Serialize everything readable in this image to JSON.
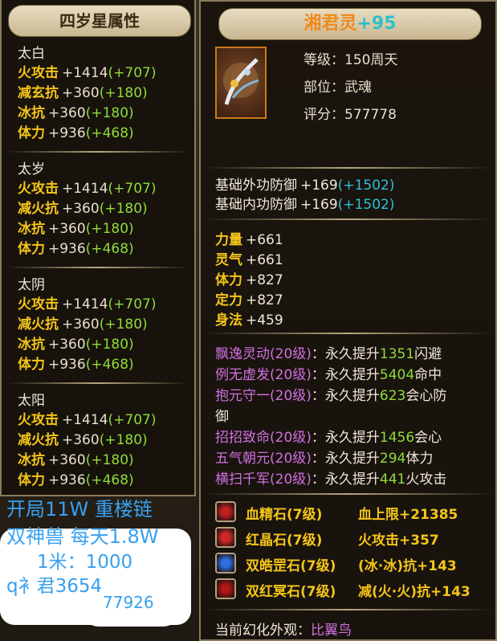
{
  "left_panel": {
    "title": "四岁星属性",
    "sections": [
      {
        "name": "太白",
        "attrs": [
          {
            "k": "火攻击",
            "v": "+1414",
            "b": "(+707)"
          },
          {
            "k": "减玄抗",
            "v": "+360",
            "b": "(+180)"
          },
          {
            "k": "冰抗",
            "v": "+360",
            "b": "(+180)"
          },
          {
            "k": "体力",
            "v": "+936",
            "b": "(+468)"
          }
        ]
      },
      {
        "name": "太岁",
        "attrs": [
          {
            "k": "火攻击",
            "v": "+1414",
            "b": "(+707)"
          },
          {
            "k": "减火抗",
            "v": "+360",
            "b": "(+180)"
          },
          {
            "k": "冰抗",
            "v": "+360",
            "b": "(+180)"
          },
          {
            "k": "体力",
            "v": "+936",
            "b": "(+468)"
          }
        ]
      },
      {
        "name": "太阴",
        "attrs": [
          {
            "k": "火攻击",
            "v": "+1414",
            "b": "(+707)"
          },
          {
            "k": "减火抗",
            "v": "+360",
            "b": "(+180)"
          },
          {
            "k": "冰抗",
            "v": "+360",
            "b": "(+180)"
          },
          {
            "k": "体力",
            "v": "+936",
            "b": "(+468)"
          }
        ]
      },
      {
        "name": "太阳",
        "attrs": [
          {
            "k": "火攻击",
            "v": "+1414",
            "b": "(+707)"
          },
          {
            "k": "减火抗",
            "v": "+360",
            "b": "(+180)"
          },
          {
            "k": "冰抗",
            "v": "+360",
            "b": "(+180)"
          },
          {
            "k": "体力",
            "v": "+936",
            "b": "(+468)"
          }
        ]
      }
    ]
  },
  "ad": {
    "line1": "开局11W 重楼链",
    "line2": "双神兽  每天1.8W",
    "line3": "1米：1000",
    "line4": "q衤君3654",
    "line5": "77926"
  },
  "item": {
    "name": "湘君灵",
    "plus": "+95",
    "icon": "spirit-weapon-icon",
    "level_label": "等级：",
    "level": "150周天",
    "slot_label": "部位：",
    "slot": "武魂",
    "score_label": "评分：",
    "score": "577778",
    "base": [
      {
        "k": "基础外功防御",
        "v": "+169",
        "b": "(+1502)"
      },
      {
        "k": "基础内功防御",
        "v": "+169",
        "b": "(+1502)"
      }
    ],
    "stats": [
      {
        "k": "力量",
        "v": "+661"
      },
      {
        "k": "灵气",
        "v": "+661"
      },
      {
        "k": "体力",
        "v": "+827"
      },
      {
        "k": "定力",
        "v": "+827"
      },
      {
        "k": "身法",
        "v": "+459"
      }
    ],
    "skills": [
      {
        "name": "飘逸灵动",
        "lvl": "(20级)",
        "sep": "：",
        "pre": "永久提升",
        "num": "1351",
        "post": "闪避"
      },
      {
        "name": "例无虚发",
        "lvl": "(20级)",
        "sep": "：",
        "pre": "永久提升",
        "num": "5404",
        "post": "命中"
      },
      {
        "name": "抱元守一",
        "lvl": "(20级)",
        "sep": "：",
        "pre": "永久提升",
        "num": "623",
        "post": "会心防"
      },
      {
        "name": "招招致命",
        "lvl": "(20级)",
        "sep": "：",
        "pre": "永久提升",
        "num": "1456",
        "post": "会心"
      },
      {
        "name": "五气朝元",
        "lvl": "(20级)",
        "sep": "：",
        "pre": "永久提升",
        "num": "294",
        "post": "体力"
      },
      {
        "name": "横扫千军",
        "lvl": "(20级)",
        "sep": "：",
        "pre": "永久提升",
        "num": "441",
        "post": "火攻击"
      }
    ],
    "skill_wrap": "御",
    "gems": [
      {
        "name": "血精石",
        "lvl": "(7级)",
        "effect": "血上限+21385",
        "color": "#c02020"
      },
      {
        "name": "红晶石",
        "lvl": "(7级)",
        "effect": "火攻击+357",
        "color": "#d02828"
      },
      {
        "name": "双皓罡石",
        "lvl": "(7级)",
        "effect": "(冰·冰)抗+143",
        "color": "#2c70e0"
      },
      {
        "name": "双红冥石",
        "lvl": "(7级)",
        "effect": "减(火·火)抗+143",
        "color": "#b01818"
      }
    ],
    "appearance_label": "当前幻化外观：",
    "appearance": "比翼鸟"
  }
}
